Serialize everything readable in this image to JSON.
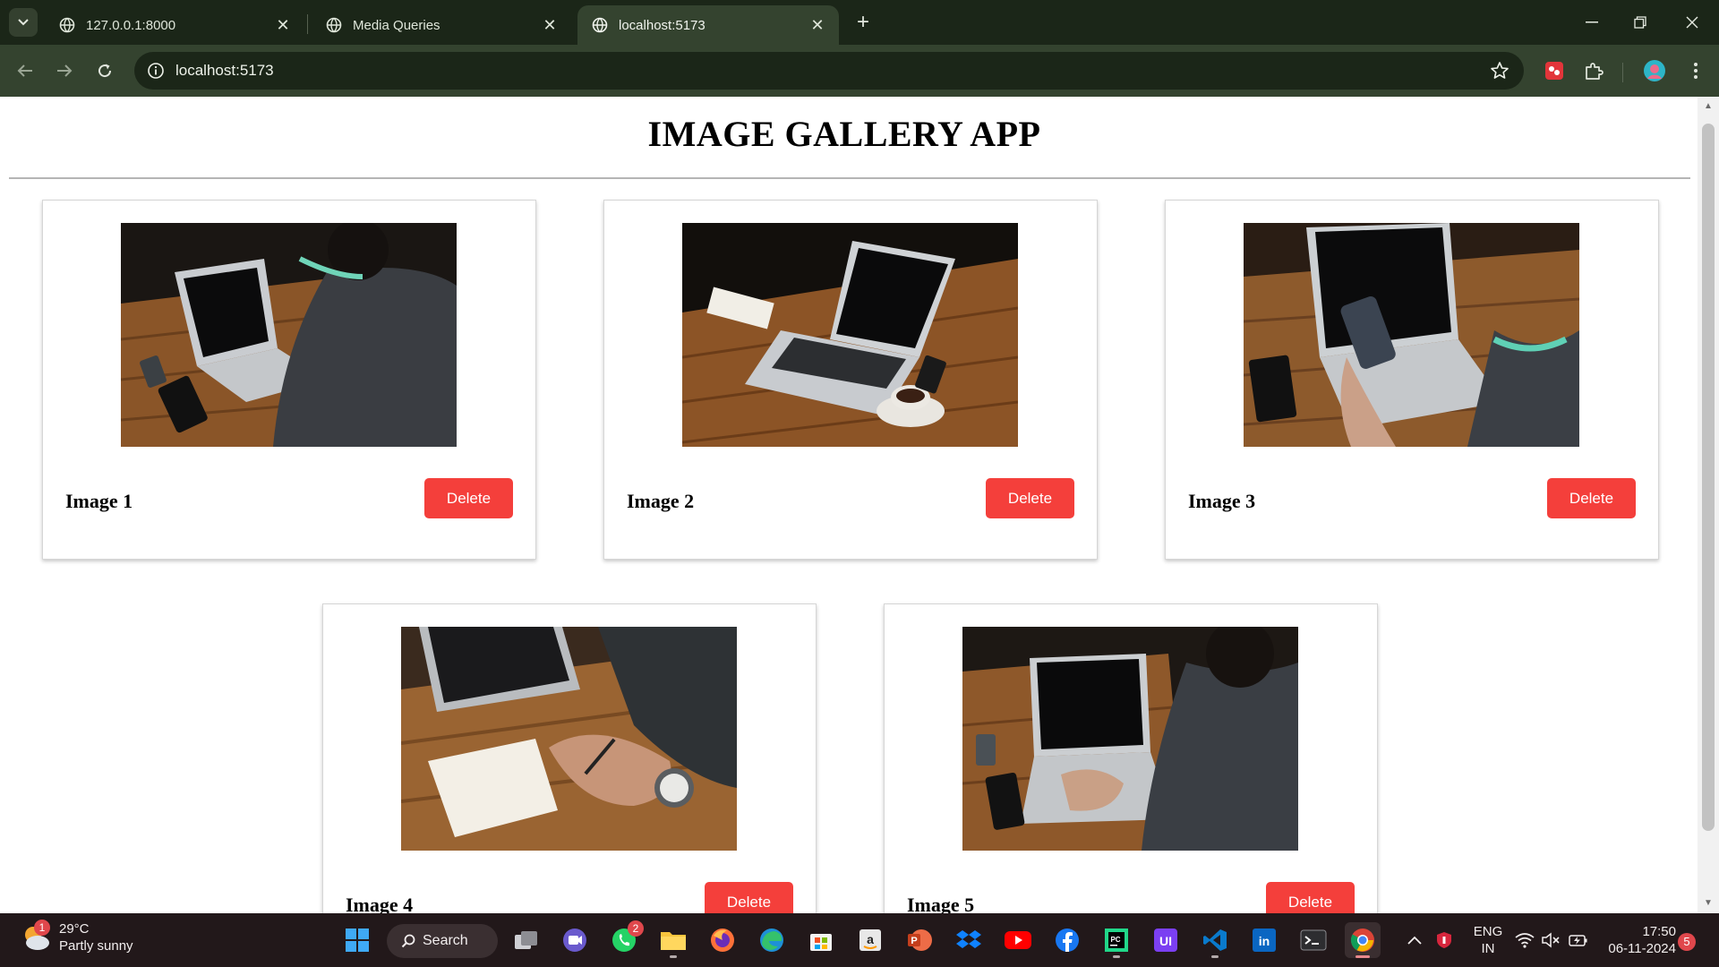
{
  "browser": {
    "tabs": [
      {
        "title": "127.0.0.1:8000",
        "active": false
      },
      {
        "title": "Media Queries",
        "active": false
      },
      {
        "title": "localhost:5173",
        "active": true
      }
    ],
    "address": "localhost:5173"
  },
  "page": {
    "title": "IMAGE GALLERY APP",
    "cards": [
      {
        "label": "Image 1",
        "delete_label": "Delete"
      },
      {
        "label": "Image 2",
        "delete_label": "Delete"
      },
      {
        "label": "Image 3",
        "delete_label": "Delete"
      },
      {
        "label": "Image 4",
        "delete_label": "Delete"
      },
      {
        "label": "Image 5",
        "delete_label": "Delete"
      }
    ]
  },
  "taskbar": {
    "weather": {
      "temp": "29°C",
      "condition": "Partly sunny",
      "badge": "1"
    },
    "search_label": "Search",
    "whatsapp_badge": "2",
    "language": {
      "line1": "ENG",
      "line2": "IN"
    },
    "time": "17:50",
    "date": "06-11-2024",
    "notification_count": "5"
  },
  "colors": {
    "delete_button": "#f43f3b",
    "chrome_frame": "#1b2618",
    "chrome_toolbar": "#34432f",
    "taskbar": "#22181a"
  }
}
